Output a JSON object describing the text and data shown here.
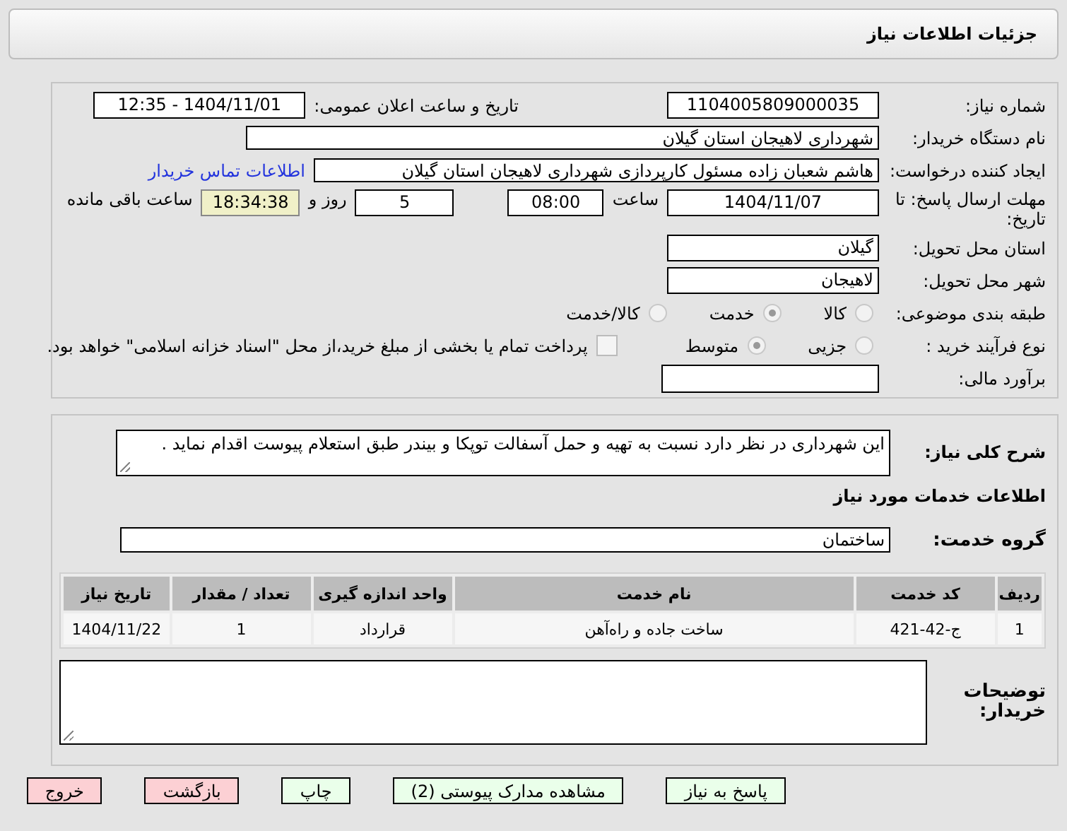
{
  "page_title": "جزئیات اطلاعات نیاز",
  "general": {
    "need_number": {
      "label": "شماره نیاز:",
      "value": "1104005809000035"
    },
    "announce": {
      "label": "تاریخ و ساعت اعلان عمومی:",
      "value": "1404/11/01 - 12:35"
    },
    "buyer_org": {
      "label": "نام دستگاه خریدار:",
      "value": "شهرداری لاهیجان استان گیلان"
    },
    "requester": {
      "label": "ایجاد کننده درخواست:",
      "value": "هاشم شعبان زاده مسئول کارپردازی شهرداری لاهیجان استان گیلان"
    },
    "contact_link": "اطلاعات تماس خریدار",
    "deadline": {
      "label": "مهلت ارسال پاسخ: تا تاریخ:",
      "date": "1404/11/07",
      "time_label": "ساعت",
      "time": "08:00",
      "days": "5",
      "days_label": "روز و",
      "remaining": "18:34:38",
      "remaining_label": "ساعت باقی مانده"
    },
    "province": {
      "label": "استان محل تحویل:",
      "value": "گیلان"
    },
    "city": {
      "label": "شهر محل تحویل:",
      "value": "لاهیجان"
    },
    "category": {
      "label": "طبقه بندی موضوعی:",
      "options": [
        {
          "label": "كالا",
          "selected": false
        },
        {
          "label": "خدمت",
          "selected": true
        },
        {
          "label": "كالا/خدمت",
          "selected": false
        }
      ]
    },
    "process": {
      "label": "نوع فرآیند خرید :",
      "options": [
        {
          "label": "جزیی",
          "selected": false
        },
        {
          "label": "متوسط",
          "selected": true
        }
      ],
      "payment": {
        "checked": false,
        "text": "پرداخت تمام یا بخشی از مبلغ خرید،از محل \"اسناد خزانه اسلامی\" خواهد بود."
      }
    },
    "budget": {
      "label": "برآورد مالی:"
    }
  },
  "details": {
    "description": {
      "label": "شرح کلی نیاز:",
      "value": "این شهرداری  در نظر دارد نسبت به  تهیه و حمل آسفالت توپکا و بیندر طبق استعلام پیوست اقدام نماید ."
    },
    "services_heading": "اطلاعات خدمات مورد نیاز",
    "service_group": {
      "label": "گروه خدمت:",
      "value": "ساختمان"
    },
    "table": {
      "columns": [
        "ردیف",
        "کد خدمت",
        "نام خدمت",
        "واحد اندازه گیری",
        "تعداد / مقدار",
        "تاریخ نیاز"
      ],
      "rows": [
        [
          "1",
          "ج-42-421",
          "ساخت جاده و راه‌آهن",
          "قرارداد",
          "1",
          "1404/11/22"
        ]
      ]
    },
    "buyer_notes": {
      "label": "توضیحات خریدار:"
    }
  },
  "buttons": [
    {
      "label": "پاسخ به نیاز",
      "kind": "normal"
    },
    {
      "label": "مشاهده مدارک پیوستی (2)",
      "kind": "normal"
    },
    {
      "label": "چاپ",
      "kind": "normal"
    },
    {
      "label": "بازگشت",
      "kind": "danger"
    },
    {
      "label": "خروج",
      "kind": "danger"
    }
  ]
}
